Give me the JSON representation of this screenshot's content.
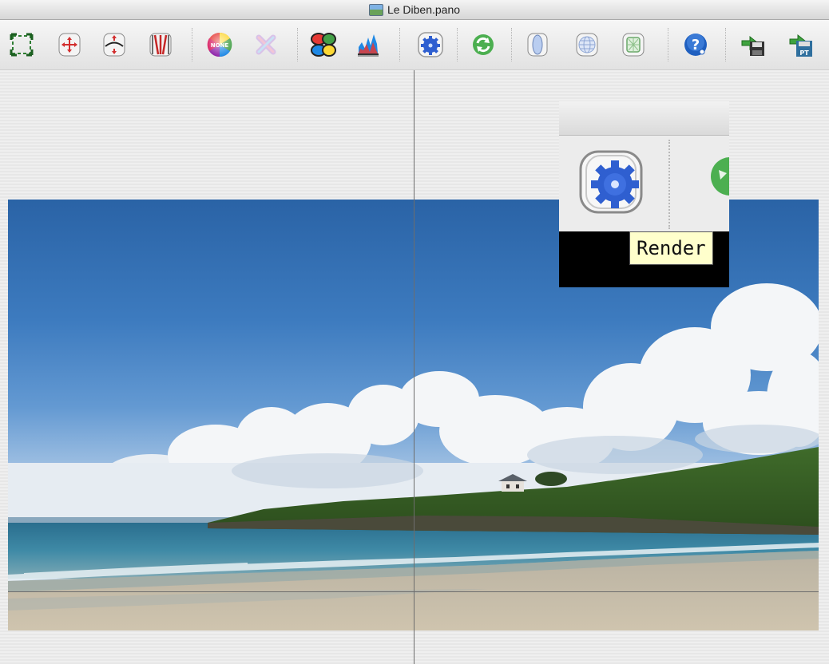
{
  "window": {
    "title": "Le Diben.pano"
  },
  "toolbar": {
    "buttons": [
      {
        "name": "crop-icon"
      },
      {
        "name": "move-center-icon"
      },
      {
        "name": "straighten-horizon-icon"
      },
      {
        "name": "fit-vertical-icon"
      },
      {
        "name": "color-correction-icon"
      },
      {
        "name": "reset-color-icon"
      },
      {
        "name": "color-channels-icon"
      },
      {
        "name": "histogram-icon"
      },
      {
        "name": "render-icon"
      },
      {
        "name": "refresh-icon"
      },
      {
        "name": "cylindrical-projection-icon"
      },
      {
        "name": "spherical-projection-icon"
      },
      {
        "name": "cube-projection-icon"
      },
      {
        "name": "help-icon"
      },
      {
        "name": "export-save-icon"
      },
      {
        "name": "export-pt-icon"
      }
    ],
    "color_badge": "NONE",
    "export_badge": "PT"
  },
  "tooltip": {
    "text": "Render"
  },
  "colors": {
    "sky_top": "#2a63a6",
    "toolbar_bg": "#e8e8e8",
    "tooltip_bg": "#ffffcc",
    "render_blue": "#2f5fd0"
  }
}
